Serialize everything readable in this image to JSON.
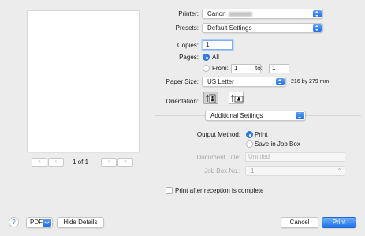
{
  "preview": {
    "page_indicator": "1 of 1",
    "nav": [
      "«",
      "‹",
      "›",
      "»"
    ]
  },
  "printer": {
    "label": "Printer:",
    "value": "Canon"
  },
  "presets": {
    "label": "Presets:",
    "value": "Default Settings"
  },
  "copies": {
    "label": "Copies:",
    "value": "1"
  },
  "pages": {
    "label": "Pages:",
    "all_label": "All",
    "from_label": "From:",
    "from_value": "1",
    "to_label": "to:",
    "to_value": "1",
    "selected": "All"
  },
  "paper_size": {
    "label": "Paper Size:",
    "value": "US Letter",
    "dimensions": "216 by 279 mm"
  },
  "orientation": {
    "label": "Orientation:",
    "selected": "portrait"
  },
  "section_popup": {
    "value": "Additional Settings"
  },
  "output_method": {
    "label": "Output Method:",
    "options": [
      "Print",
      "Save in Job Box"
    ],
    "selected": "Print"
  },
  "document_title": {
    "label": "Document Title:",
    "placeholder": "Untitled"
  },
  "job_box_no": {
    "label": "Job Box No.:",
    "value": "1"
  },
  "print_after": {
    "label": "Print after reception is complete",
    "checked": false
  },
  "footer": {
    "help": "?",
    "pdf": "PDF",
    "hide_details": "Hide Details",
    "cancel": "Cancel",
    "print": "Print"
  },
  "colors": {
    "accent": "#1f6fe6",
    "background": "#ececec"
  }
}
